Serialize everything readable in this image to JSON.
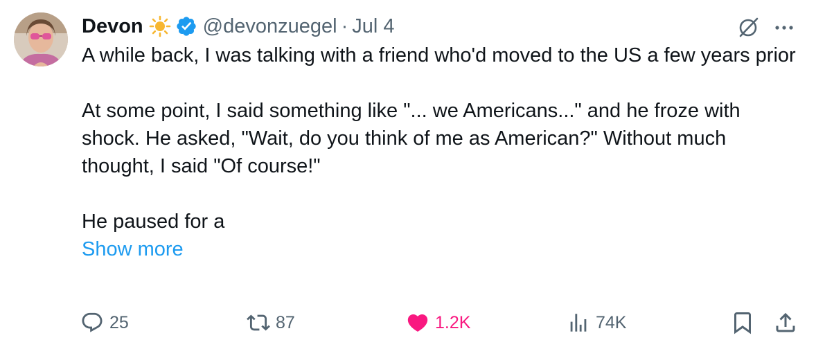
{
  "tweet": {
    "author_name": "Devon",
    "handle": "@devonzuegel",
    "separator": "·",
    "date": "Jul 4",
    "paragraphs": [
      "A while back, I was talking with a friend who'd moved to the US a few years prior",
      "At some point, I said something like \"... we Americans...\" and he froze with shock. He asked, \"Wait, do you think of me as American?\" Without much thought, I said \"Of course!\"",
      "He paused for a"
    ],
    "show_more": "Show more"
  },
  "icons": {
    "sun": "sun-emoji-icon",
    "verified": "verified-badge-icon",
    "grok": "grok-icon",
    "more": "more-icon",
    "reply": "reply-icon",
    "retweet": "retweet-icon",
    "like": "heart-icon",
    "views": "views-icon",
    "bookmark": "bookmark-icon",
    "share": "share-icon"
  },
  "actions": {
    "replies": "25",
    "retweets": "87",
    "likes": "1.2K",
    "views": "74K"
  },
  "colors": {
    "text": "#0f1419",
    "secondary": "#536471",
    "accent": "#1d9bf0",
    "like": "#f91880",
    "sun": "#f7b731"
  }
}
